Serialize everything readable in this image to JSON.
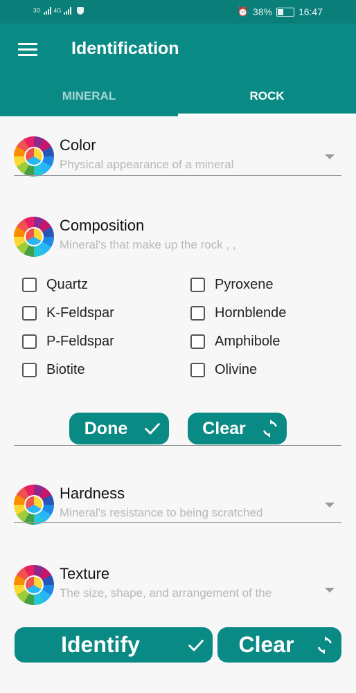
{
  "status_bar": {
    "network_1": "3G",
    "network_2": "4G",
    "battery_pct": "38%",
    "time": "16:47",
    "battery_level": 0.38
  },
  "app_bar": {
    "title": "Identification",
    "menu_icon": "hamburger-menu-icon"
  },
  "tabs": [
    {
      "label": "MINERAL",
      "selected": false
    },
    {
      "label": "ROCK",
      "selected": true
    }
  ],
  "fields": {
    "color": {
      "title": "Color",
      "subtitle": "Physical appearance of a mineral"
    },
    "composition": {
      "title": "Composition",
      "subtitle": "Mineral's that make up the rock ,  ,"
    },
    "hardness": {
      "title": "Hardness",
      "subtitle": "Mineral's resistance to being scratched"
    },
    "texture": {
      "title": "Texture",
      "subtitle": "The size, shape, and arrangement of the"
    }
  },
  "composition_options": [
    "Quartz",
    "Pyroxene",
    "K-Feldspar",
    "Hornblende",
    "P-Feldspar",
    "Amphibole",
    "Biotite",
    "Olivine"
  ],
  "composition_buttons": {
    "done": "Done",
    "clear": "Clear"
  },
  "bottom_buttons": {
    "identify": "Identify",
    "clear": "Clear"
  },
  "colors": {
    "primary": "#0a8a84",
    "status_bar": "#0a7f7a"
  }
}
